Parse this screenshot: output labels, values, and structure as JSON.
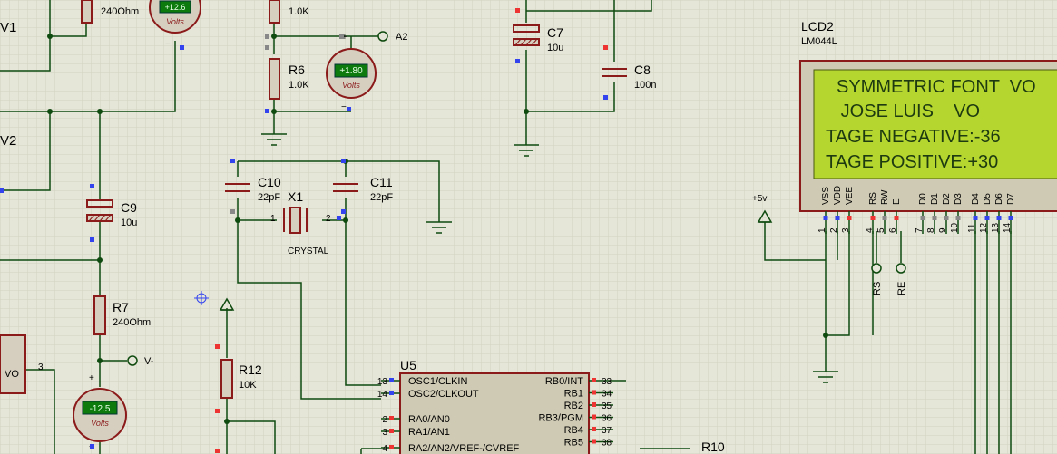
{
  "components": {
    "v1": {
      "ref": "V1"
    },
    "v2": {
      "ref": "V2"
    },
    "r_top_left": {
      "value": "240Ohm"
    },
    "r_top_mid": {
      "value": "1.0K"
    },
    "r6": {
      "ref": "R6",
      "value": "1.0K"
    },
    "r7": {
      "ref": "R7",
      "value": "240Ohm"
    },
    "r12": {
      "ref": "R12",
      "value": "10K"
    },
    "r10": {
      "ref": "R10"
    },
    "c7": {
      "ref": "C7",
      "value": "10u"
    },
    "c8": {
      "ref": "C8",
      "value": "100n"
    },
    "c9": {
      "ref": "C9",
      "value": "10u"
    },
    "c10": {
      "ref": "C10",
      "value": "22pF"
    },
    "c11": {
      "ref": "C11",
      "value": "22pF"
    },
    "x1": {
      "ref": "X1",
      "value": "CRYSTAL",
      "pin1": "1",
      "pin2": "2"
    },
    "vo_block": {
      "label": "VO",
      "pin": "3"
    }
  },
  "voltmeters": [
    {
      "reading": "+12.6",
      "unit": "Volts"
    },
    {
      "reading": "+1.80",
      "unit": "Volts"
    },
    {
      "reading": "-12.5",
      "unit": "Volts"
    }
  ],
  "terminals": {
    "a2": "A2",
    "vminus": "V-",
    "plus5v": "+5v",
    "rs": "RS",
    "re": "RE"
  },
  "lcd": {
    "ref": "LCD2",
    "model": "LM044L",
    "lines": [
      "SYMMETRIC FONT  VO",
      "   JOSE LUIS    VO",
      "TAGE NEGATIVE:-36",
      "TAGE POSITIVE:+30"
    ],
    "pin_names": [
      "VSS",
      "VDD",
      "VEE",
      "RS",
      "RW",
      "E",
      "D0",
      "D1",
      "D2",
      "D3",
      "D4",
      "D5",
      "D6",
      "D7"
    ],
    "pin_numbers": [
      "1",
      "2",
      "3",
      "4",
      "5",
      "6",
      "7",
      "8",
      "9",
      "10",
      "11",
      "12",
      "13",
      "14"
    ]
  },
  "u5": {
    "ref": "U5",
    "left_pins": [
      {
        "num": "13",
        "name": "OSC1/CLKIN"
      },
      {
        "num": "14",
        "name": "OSC2/CLKOUT"
      },
      {
        "num": "2",
        "name": "RA0/AN0"
      },
      {
        "num": "3",
        "name": "RA1/AN1"
      },
      {
        "num": "4",
        "name": "RA2/AN2/VREF-/CVREF"
      }
    ],
    "right_pins": [
      {
        "num": "33",
        "name": "RB0/INT"
      },
      {
        "num": "34",
        "name": "RB1"
      },
      {
        "num": "35",
        "name": "RB2"
      },
      {
        "num": "36",
        "name": "RB3/PGM"
      },
      {
        "num": "37",
        "name": "RB4"
      },
      {
        "num": "38",
        "name": "RB5"
      }
    ]
  },
  "colors": {
    "wire": "#0f4a0f",
    "component": "#8b1a1a",
    "component_fill": "#d6cfc0",
    "chip_fill": "#cfcab4",
    "lcd_screen": "#b5d62e",
    "lcd_text": "#1d3a10",
    "meter_display": "#0c7a0c",
    "pin_blue": "#3344ee",
    "pin_red": "#ee3333",
    "pin_gray": "#888888",
    "grid": "#d4d4c4"
  }
}
